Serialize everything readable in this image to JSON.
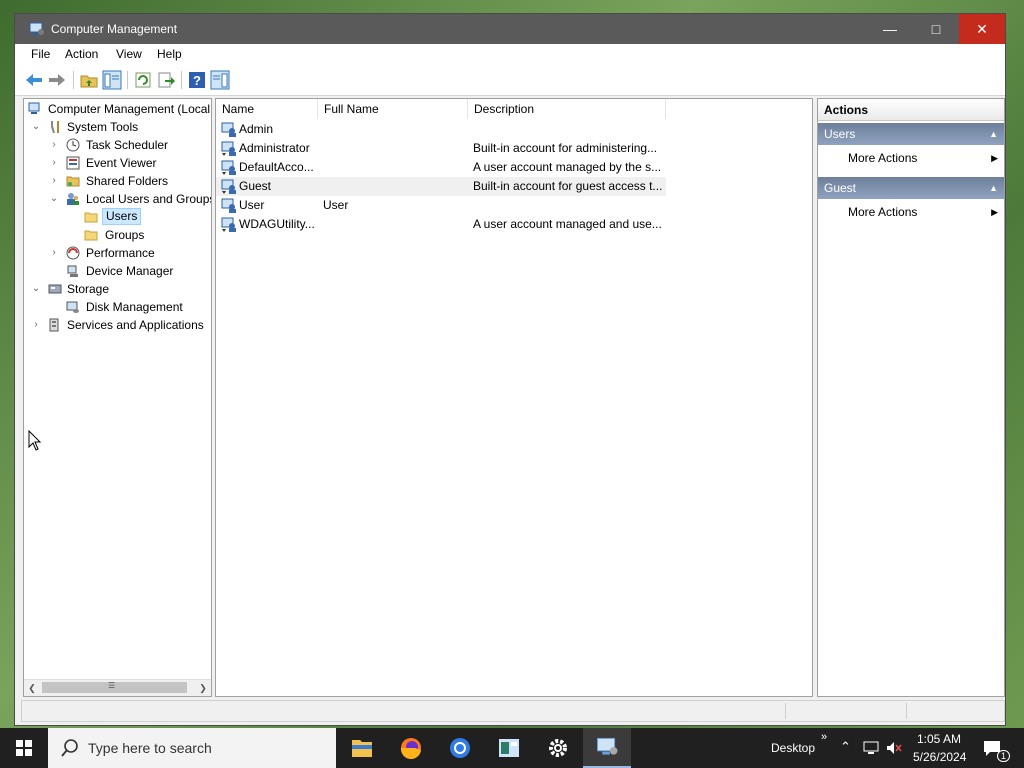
{
  "window": {
    "title": "Computer Management",
    "min": "—",
    "max": "□",
    "close": "✕"
  },
  "menu": [
    "File",
    "Action",
    "View",
    "Help"
  ],
  "tree": {
    "root": "Computer Management (Local",
    "system_tools": "System Tools",
    "task_scheduler": "Task Scheduler",
    "event_viewer": "Event Viewer",
    "shared_folders": "Shared Folders",
    "local_users": "Local Users and Groups",
    "users": "Users",
    "groups": "Groups",
    "performance": "Performance",
    "device_manager": "Device Manager",
    "storage": "Storage",
    "disk_management": "Disk Management",
    "services": "Services and Applications"
  },
  "list": {
    "columns": [
      "Name",
      "Full Name",
      "Description"
    ],
    "rows": [
      {
        "name": "Admin",
        "full_name": "",
        "description": ""
      },
      {
        "name": "Administrator",
        "full_name": "",
        "description": "Built-in account for administering..."
      },
      {
        "name": "DefaultAcco...",
        "full_name": "",
        "description": "A user account managed by the s..."
      },
      {
        "name": "Guest",
        "full_name": "",
        "description": "Built-in account for guest access t..."
      },
      {
        "name": "User",
        "full_name": "User",
        "description": ""
      },
      {
        "name": "WDAGUtility...",
        "full_name": "",
        "description": "A user account managed and use..."
      }
    ]
  },
  "actions": {
    "title": "Actions",
    "section1": "Users",
    "section1_item": "More Actions",
    "section2": "Guest",
    "section2_item": "More Actions"
  },
  "taskbar": {
    "search_placeholder": "Type here to search",
    "desktop_label": "Desktop",
    "time": "1:05 AM",
    "date": "5/26/2024",
    "notification_count": "1"
  }
}
